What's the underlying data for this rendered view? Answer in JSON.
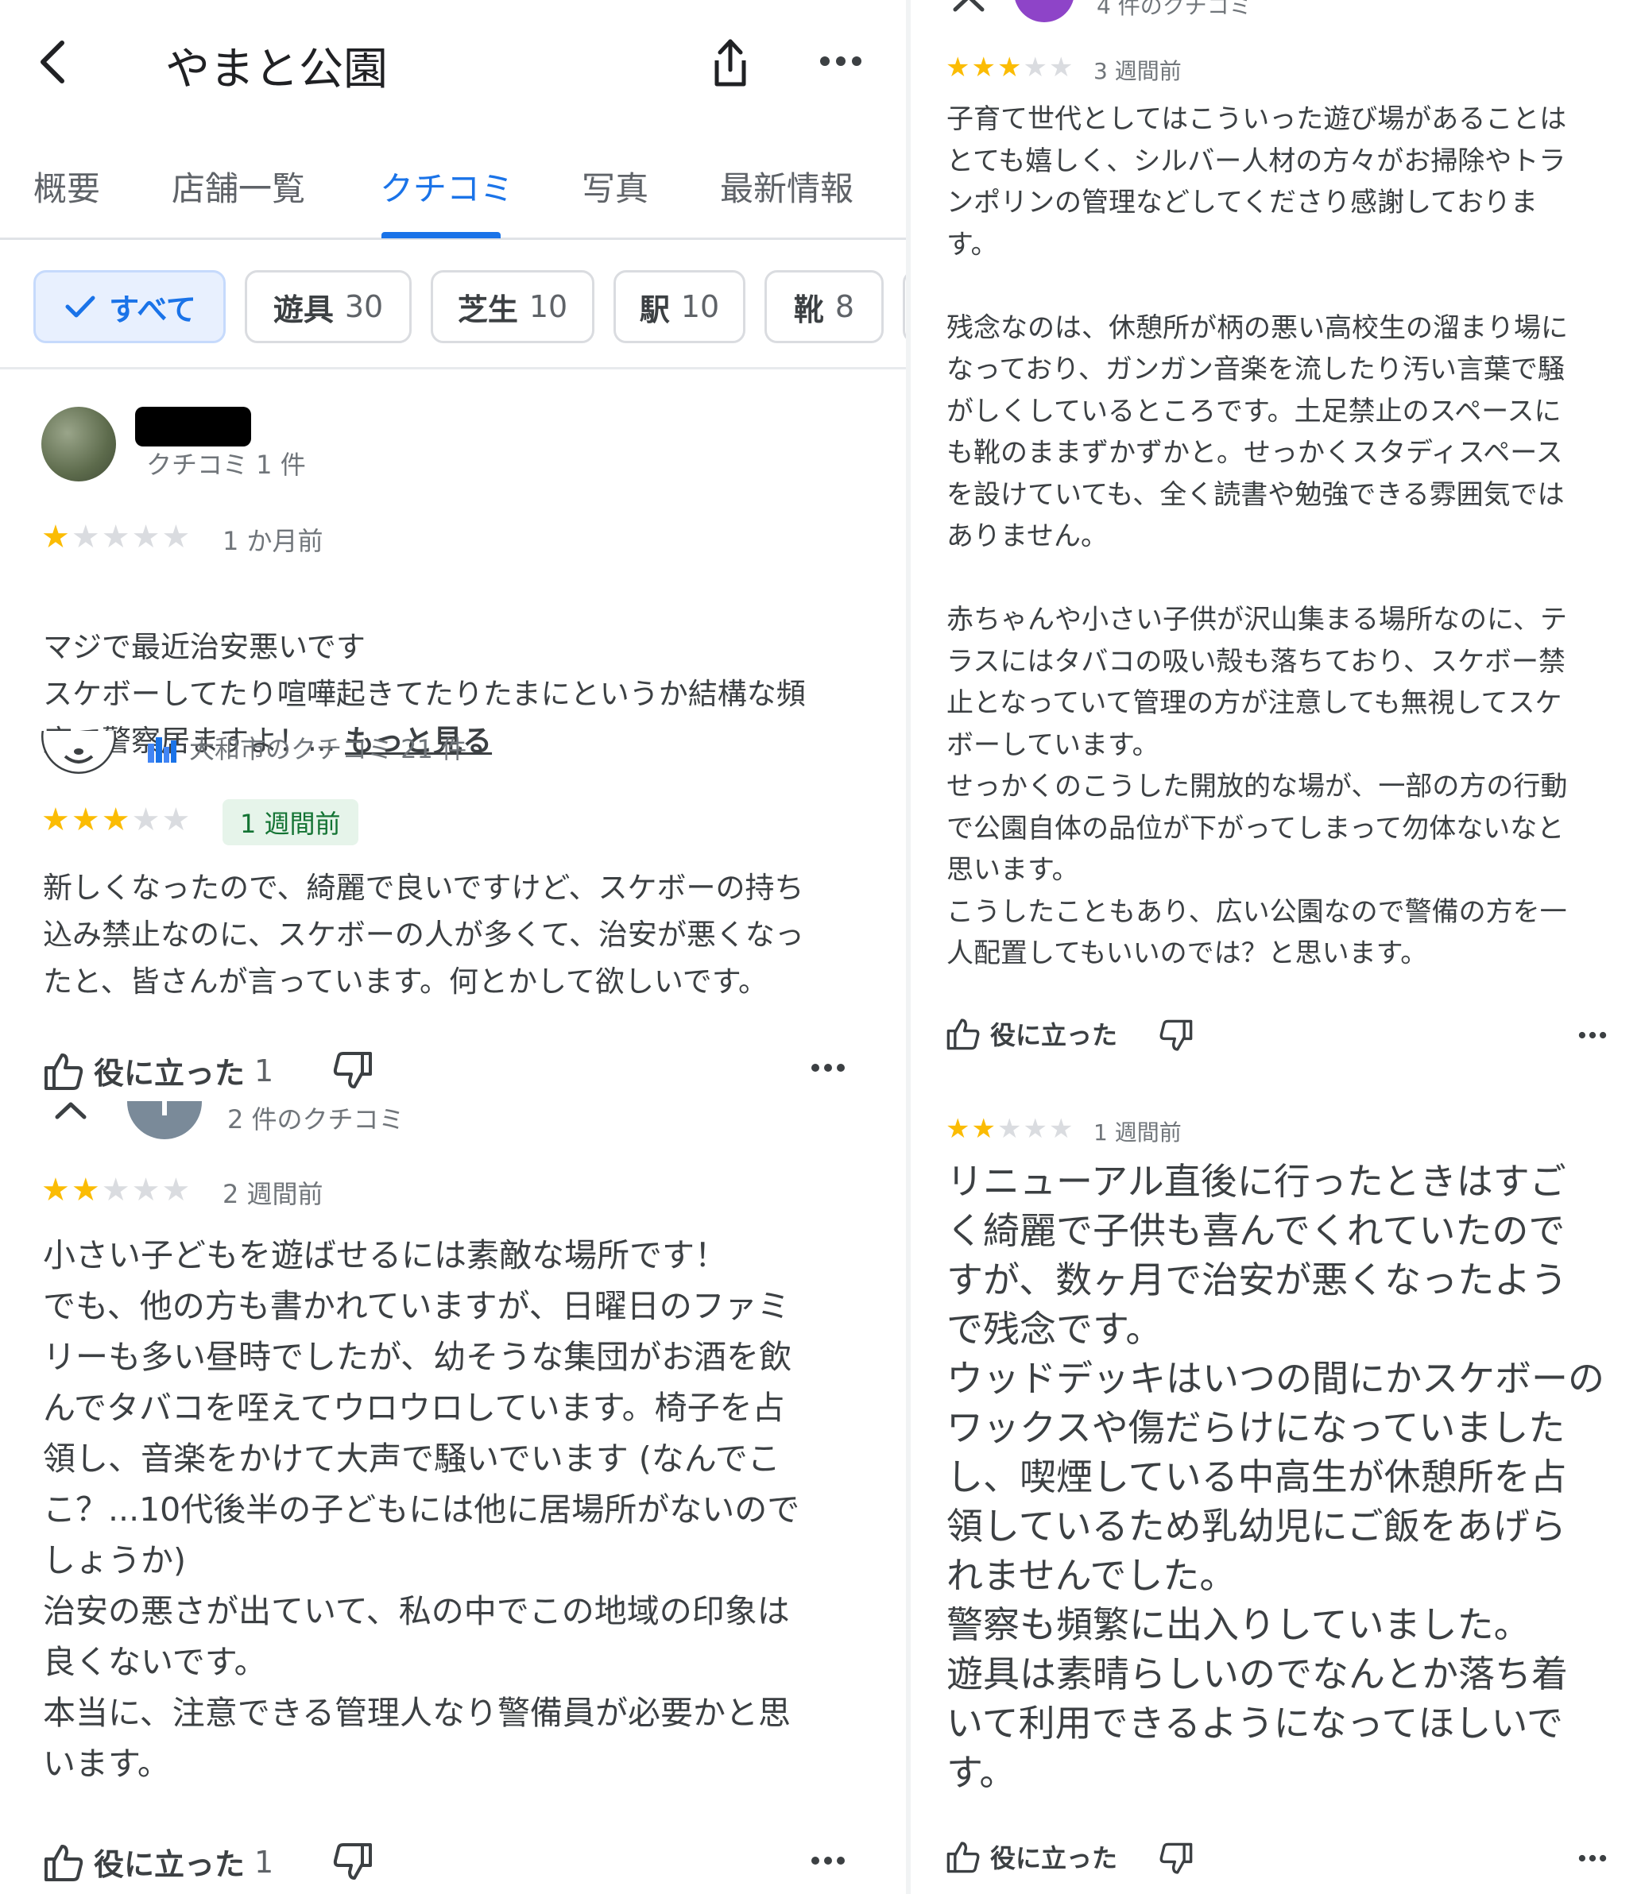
{
  "header": {
    "title": "やまと公園",
    "back_icon": "chevron-left-icon",
    "share_icon": "share-icon",
    "more_icon": "more-horizontal-icon"
  },
  "tabs": [
    "概要",
    "店舗一覧",
    "クチコミ",
    "写真",
    "最新情報"
  ],
  "active_tab": "クチコミ",
  "filter_chips": [
    {
      "label": "すべて",
      "count": "",
      "selected": true
    },
    {
      "label": "遊具",
      "count": "30"
    },
    {
      "label": "芝生",
      "count": "10"
    },
    {
      "label": "駅",
      "count": "10"
    },
    {
      "label": "靴",
      "count": "8"
    }
  ],
  "colors": {
    "accent": "#1a73e8",
    "star": "#fbbc04",
    "star_empty": "#dadce0",
    "badge_bg": "#e6f4ea",
    "badge_text": "#137333"
  },
  "left_reviews": [
    {
      "author_meta": "クチコミ 1 件",
      "rating": 1,
      "when": "1 か月前",
      "text": "マジで最近治安悪いです\nスケボーしてたり喧嘩起きてたりたまにというか結構な頻\n度で警察居ますよ！...",
      "more_link": "もっと見る"
    },
    {
      "author_meta": "大和市のクチコミ 21 件",
      "rating": 3,
      "when": "1 週間前",
      "text": "新しくなったので、綺麗で良いですけど、スケボーの持ち\n込み禁止なのに、スケボーの人が多くて、治安が悪くなっ\nたと、皆さんが言っています。何とかして欲しいです。",
      "helpful_label": "役に立った",
      "helpful_count": "1"
    },
    {
      "author_meta": "2 件のクチコミ",
      "rating": 2,
      "when": "2 週間前",
      "text": "小さい子どもを遊ばせるには素敵な場所です！\nでも、他の方も書かれていますが、日曜日のファミ\nリーも多い昼時でしたが、幼そうな集団がお酒を飲\nんでタバコを咥えてウロウロしています。椅子を占\n領し、音楽をかけて大声で騒いでいます (なんでこ\nこ？...10代後半の子どもには他に居場所がないので\nしょうか)\n治安の悪さが出ていて、私の中でこの地域の印象は\n良くないです。\n本当に、注意できる管理人なり警備員が必要かと思\nいます。",
      "helpful_label": "役に立った",
      "helpful_count": "1"
    }
  ],
  "right_reviews": [
    {
      "author_meta": "4 件のクチコミ",
      "rating": 3,
      "when": "3 週間前",
      "text": "子育て世代としてはこういった遊び場があることは\nとても嬉しく、シルバー人材の方々がお掃除やトラ\nンポリンの管理などしてくださり感謝しておりま\nす。\n\n残念なのは、休憩所が柄の悪い高校生の溜まり場に\nなっており、ガンガン音楽を流したり汚い言葉で騒\nがしくしているところです。土足禁止のスペースに\nも靴のままずかずかと。せっかくスタディスペース\nを設けていても、全く読書や勉強できる雰囲気では\nありません。\n\n赤ちゃんや小さい子供が沢山集まる場所なのに、テ\nラスにはタバコの吸い殻も落ちており、スケボー禁\n止となっていて管理の方が注意しても無視してスケ\nボーしています。\nせっかくのこうした開放的な場が、一部の方の行動\nで公園自体の品位が下がってしまって勿体ないなと\n思います。\nこうしたこともあり、広い公園なので警備の方を一\n人配置してもいいのでは？と思います。",
      "helpful_label": "役に立った"
    },
    {
      "rating": 2,
      "when": "1 週間前",
      "text": "リニューアル直後に行ったときはすご\nく綺麗で子供も喜んでくれていたので\nすが、数ヶ月で治安が悪くなったよう\nで残念です。\nウッドデッキはいつの間にかスケボーの\nワックスや傷だらけになっていました\nし、喫煙している中高生が休憩所を占\n領しているため乳幼児にご飯をあげら\nれませんでした。\n警察も頻繁に出入りしていました。\n遊具は素晴らしいのでなんとか落ち着\nいて利用できるようになってほしいで\nす。",
      "helpful_label": "役に立った"
    }
  ]
}
